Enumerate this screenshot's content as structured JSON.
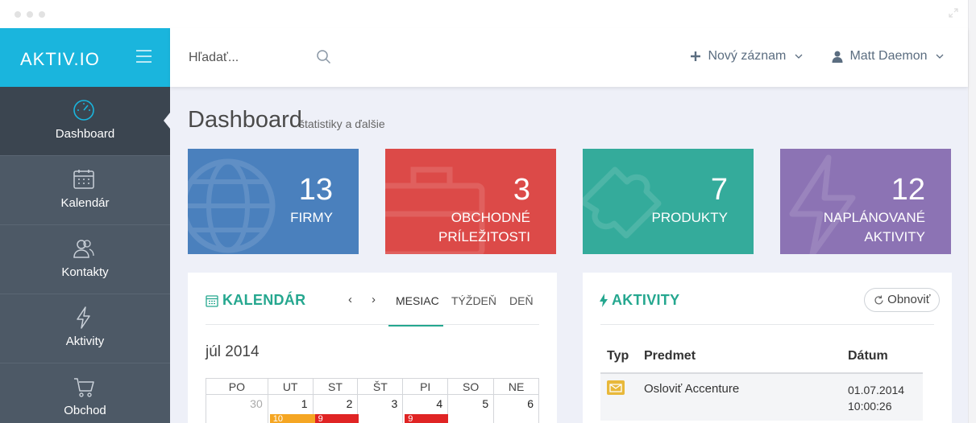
{
  "brand": {
    "logo": "AKTIV.IO"
  },
  "search": {
    "placeholder": "Hľadať..."
  },
  "topbar": {
    "new_record": "Nový záznam",
    "user_name": "Matt Daemon"
  },
  "sidebar": {
    "items": [
      {
        "label": "Dashboard",
        "icon": "dashboard-gauge-icon",
        "active": true
      },
      {
        "label": "Kalendár",
        "icon": "calendar-icon"
      },
      {
        "label": "Kontakty",
        "icon": "contacts-icon"
      },
      {
        "label": "Aktivity",
        "icon": "lightning-icon"
      },
      {
        "label": "Obchod",
        "icon": "cart-icon"
      }
    ]
  },
  "page": {
    "title": "Dashboard",
    "subtitle": "štatistiky a ďalšie"
  },
  "tiles": [
    {
      "value": "13",
      "label": "FIRMY",
      "color": "#4a80bd",
      "icon": "globe-icon"
    },
    {
      "value": "3",
      "label": "OBCHODNÉ\nPRÍLEŽITOSTI",
      "color": "#dc4a48",
      "icon": "briefcase-icon"
    },
    {
      "value": "7",
      "label": "PRODUKTY",
      "color": "#34ab9b",
      "icon": "puzzle-icon"
    },
    {
      "value": "12",
      "label": "NAPLÁNOVANÉ\nAKTIVITY",
      "color": "#8c73b4",
      "icon": "lightning-icon"
    }
  ],
  "calendar": {
    "title": "KALENDÁR",
    "prev": "‹",
    "next": "›",
    "tabs": [
      "MESIAC",
      "TÝŽDEŇ",
      "DEŇ"
    ],
    "active_tab": "MESIAC",
    "month": "júl 2014",
    "weekdays": [
      "PO",
      "UT",
      "ST",
      "ŠT",
      "PI",
      "SO",
      "NE"
    ],
    "week": [
      "30",
      "1",
      "2",
      "3",
      "4",
      "5",
      "6"
    ],
    "events": [
      {
        "day_index": 1,
        "text": "10",
        "color": "#f5a623"
      },
      {
        "day_index": 2,
        "text": "9",
        "color": "#e02424"
      },
      {
        "day_index": 4,
        "text": "9",
        "color": "#e02424"
      }
    ]
  },
  "activities": {
    "title": "AKTIVITY",
    "refresh": "Obnoviť",
    "columns": [
      "Typ",
      "Predmet",
      "Dátum"
    ],
    "rows": [
      {
        "type_icon": "mail-icon",
        "subject": "Osloviť Accenture",
        "date": "01.07.2014",
        "time": "10:00:26"
      }
    ]
  },
  "colors": {
    "accent": "#1ab5dd",
    "sidebar": "#4d5966",
    "sidebar_active": "#3b4550",
    "green": "#25a78f"
  }
}
